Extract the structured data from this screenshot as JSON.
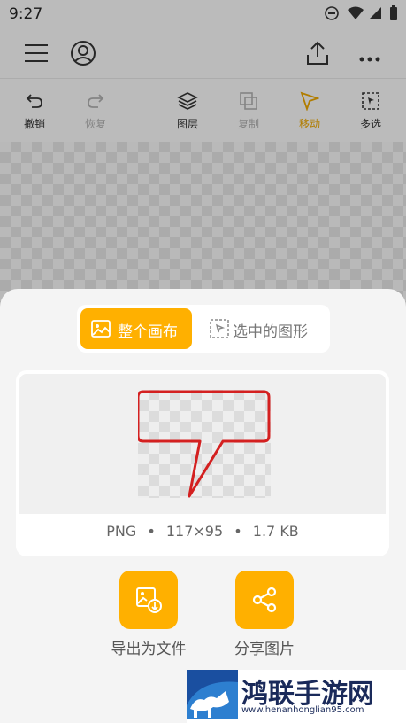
{
  "status_bar": {
    "time": "9:27"
  },
  "toolbar": {
    "undo": "撤销",
    "redo": "恢复",
    "layers": "图层",
    "copy": "复制",
    "move": "移动",
    "multiselect": "多选"
  },
  "export_sheet": {
    "tabs": {
      "whole_canvas": "整个画布",
      "selected_shapes": "选中的图形"
    },
    "preview": {
      "format": "PNG",
      "dimensions": "117×95",
      "size": "1.7 KB",
      "separator": "•"
    },
    "actions": {
      "export_file": "导出为文件",
      "share_image": "分享图片"
    }
  },
  "watermark": {
    "title": "鸿联手游网",
    "url": "www.henanhonglian95.com"
  },
  "colors": {
    "accent": "#ffb000",
    "active_tool": "#e3a000",
    "shape_stroke": "#d42020"
  }
}
